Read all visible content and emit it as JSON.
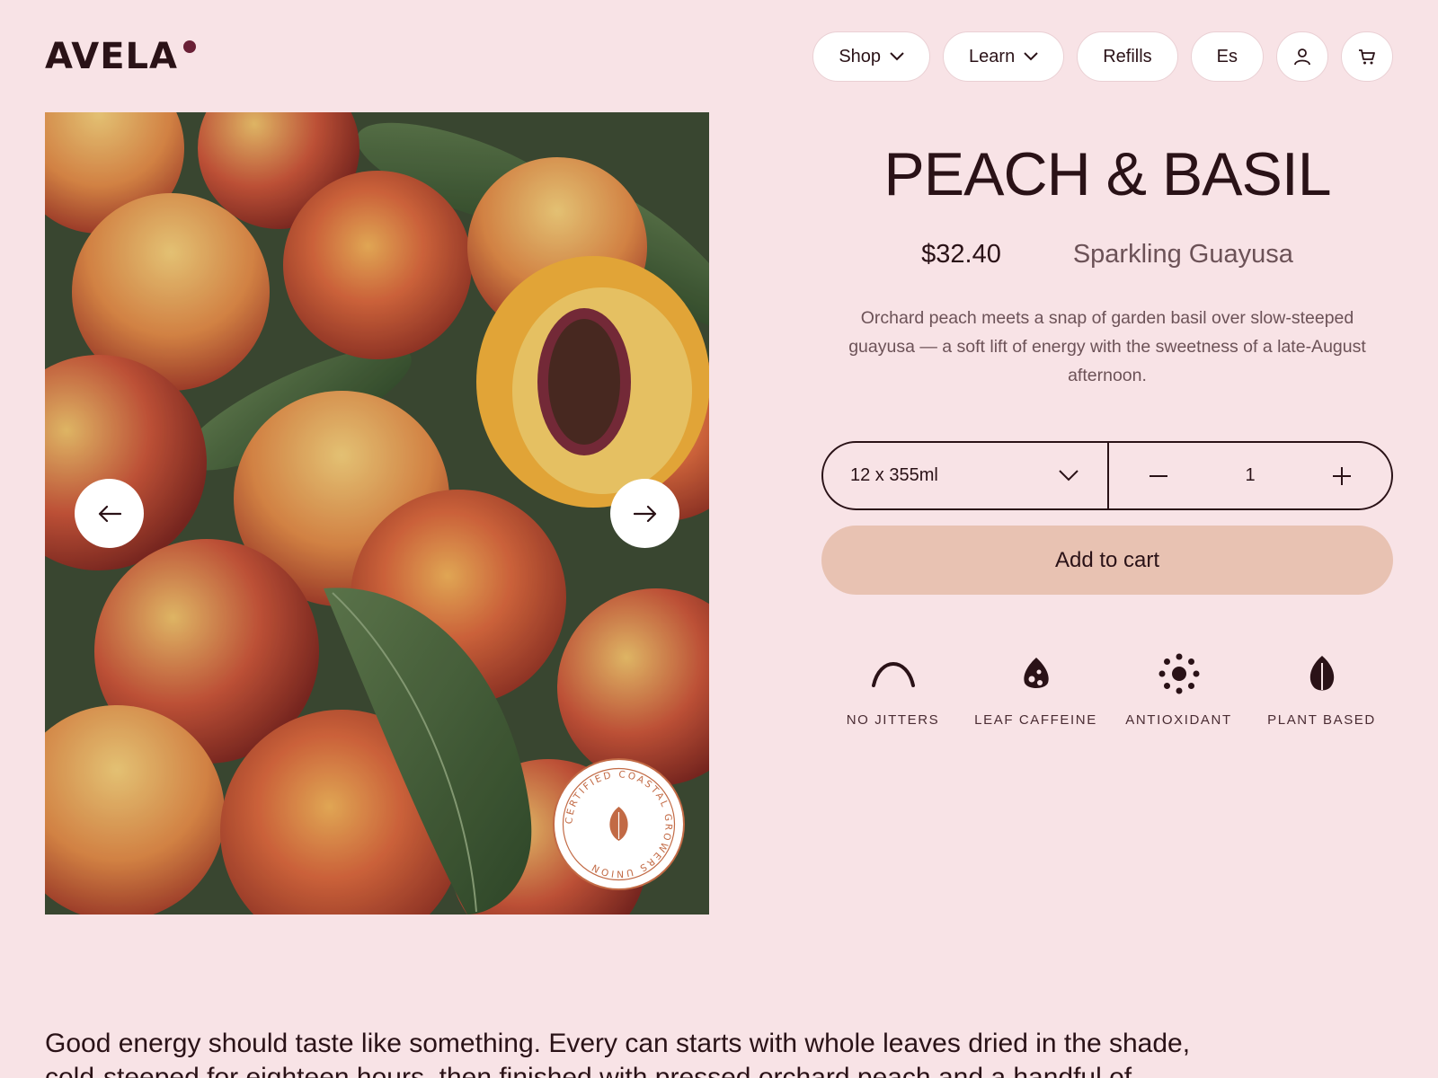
{
  "brand": {
    "name": "AVELA",
    "accent_color": "#6a2036"
  },
  "nav": {
    "items": [
      {
        "label": "Shop",
        "has_dropdown": true
      },
      {
        "label": "Learn",
        "has_dropdown": true
      },
      {
        "label": "Refills",
        "has_dropdown": false
      },
      {
        "label": "Es",
        "has_dropdown": false
      }
    ],
    "account_icon": "user-icon",
    "cart_icon": "cart-icon"
  },
  "gallery": {
    "prev_icon": "arrow-left-icon",
    "next_icon": "arrow-right-icon",
    "badge_text": "CERTIFIED COASTAL GROWERS UNION",
    "badge_icon": "leaf-icon",
    "badge_color": "#c26a45"
  },
  "product": {
    "title": "PEACH & BASIL",
    "price": "$32.40",
    "subtitle": "Sparkling Guayusa",
    "description": "Orchard peach meets a snap of garden basil over slow-steeped guayusa — a soft lift of energy with the sweetness of a late-August afternoon.",
    "size_selected": "12 x 355ml",
    "quantity": "1",
    "add_to_cart_label": "Add to cart",
    "button_color": "#e8c2b2"
  },
  "features": [
    {
      "label": "NO JITTERS",
      "icon": "arc-icon"
    },
    {
      "label": "LEAF CAFFEINE",
      "icon": "leaf-drop-icon"
    },
    {
      "label": "ANTIOXIDANT",
      "icon": "sparkle-dots-icon"
    },
    {
      "label": "PLANT BASED",
      "icon": "plant-leaf-icon"
    }
  ],
  "story": {
    "text": "Good energy should taste like something. Every can starts with whole leaves dried in the shade, cold-steeped for eighteen hours, then finished with pressed orchard peach and a handful of"
  }
}
